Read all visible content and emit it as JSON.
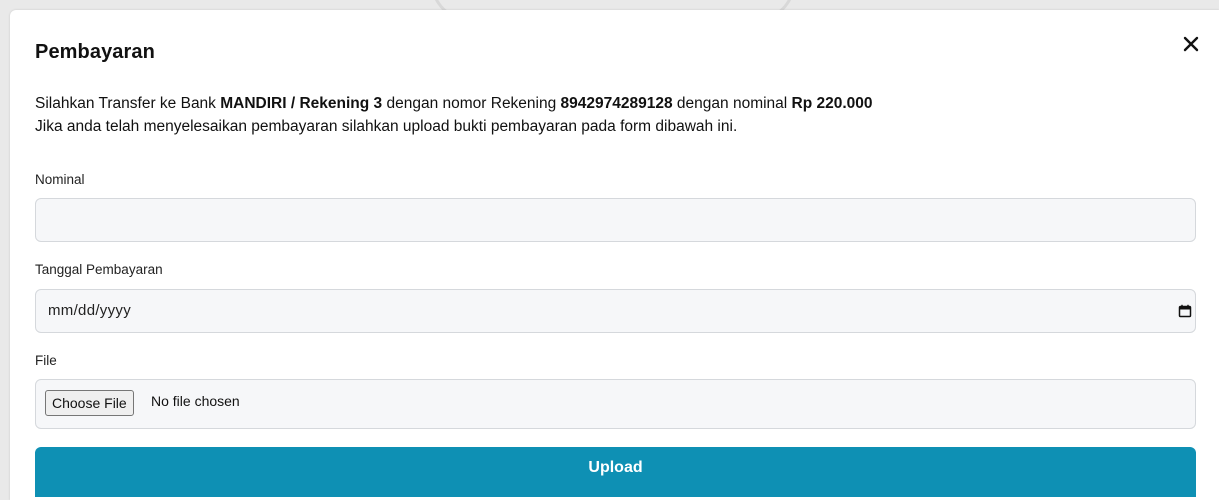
{
  "modal": {
    "title": "Pembayaran",
    "close_icon": "close-icon",
    "info": {
      "line1_prefix": "Silahkan Transfer ke Bank ",
      "bank": "MANDIRI / Rekening 3",
      "line1_mid": " dengan nomor Rekening ",
      "account_number": "8942974289128",
      "line1_mid2": " dengan nominal ",
      "amount": "Rp 220.000",
      "line2": "Jika anda telah menyelesaikan pembayaran silahkan upload bukti pembayaran pada form dibawah ini."
    },
    "form": {
      "nominal_label": "Nominal",
      "nominal_value": "",
      "date_label": "Tanggal Pembayaran",
      "date_placeholder": "mm/dd/yyyy",
      "calendar_icon": "calendar-icon",
      "file_label": "File",
      "file_button": "Choose File",
      "file_status": "No file chosen"
    },
    "upload_button": "Upload",
    "colors": {
      "primary": "#0e90b4",
      "field_bg": "#f6f7f9",
      "field_border": "#d5d8dc"
    }
  }
}
